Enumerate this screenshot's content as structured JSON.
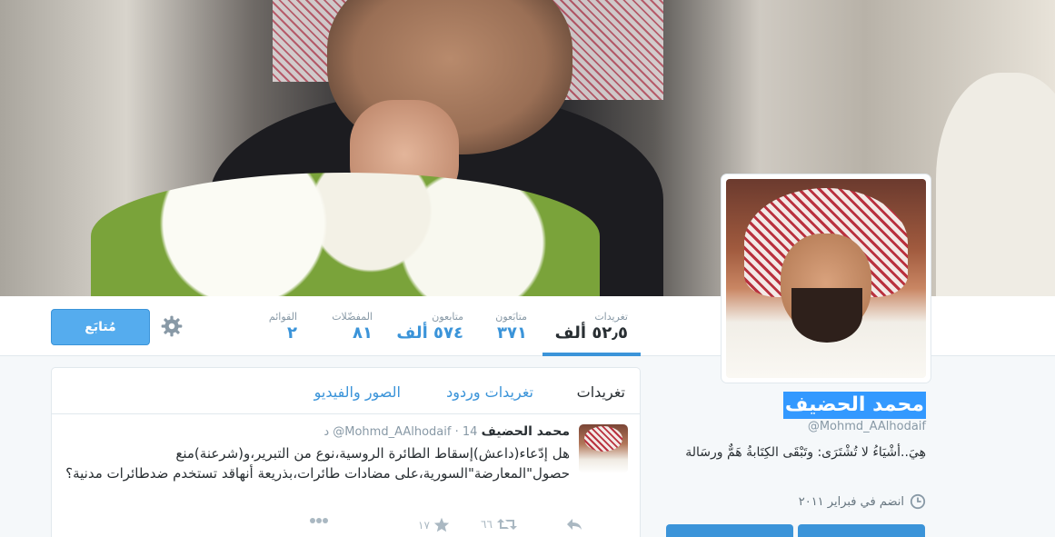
{
  "header": {
    "follow_label": "مُتابَع"
  },
  "stats": [
    {
      "label": "تغريدات",
      "value": "٥٢٫٥ ألف",
      "active": true
    },
    {
      "label": "متابَعون",
      "value": "٣٧١"
    },
    {
      "label": "متابعون",
      "value": "٥٧٤ ألف"
    },
    {
      "label": "المفضّلات",
      "value": "٨١"
    },
    {
      "label": "القوائم",
      "value": "٢"
    }
  ],
  "profile": {
    "full_name": "محمد الحضيف",
    "screen_name": "@Mohmd_AAlhodaif",
    "bio": "هِيَ..أشْيَاءُ لا تُشْتَرَى: وتَبْقَى الكِتَابةُ هَمٌّ ورسَالة",
    "joined": "انضم في فبراير ٢٠١١"
  },
  "timeline": {
    "tabs": [
      {
        "label": "تغريدات",
        "active": true
      },
      {
        "label": "تغريدات وردود"
      },
      {
        "label": "الصور والفيديو"
      }
    ],
    "tweet": {
      "name": "محمد الحضيف",
      "handle": "@Mohmd_AAlhodaif",
      "separator": "·",
      "time": "14 د",
      "text": "هل إدّعاء(داعش)إسقاط الطائرة الروسية،نوع من التبرير،و(شرعنة)منع حصول\"المعارضة\"السورية،على مضادات طائرات،بذريعة أنهاقد تستخدم ضدطائرات مدنية؟",
      "retweets": "٦٦",
      "favorites": "١٧"
    }
  },
  "colors": {
    "accent": "#3b94d9",
    "follow_button": "#55acee",
    "selection": "#3399ff"
  },
  "icons": [
    "gear-icon",
    "clock-icon",
    "reply-icon",
    "retweet-icon",
    "star-icon",
    "more-icon"
  ]
}
